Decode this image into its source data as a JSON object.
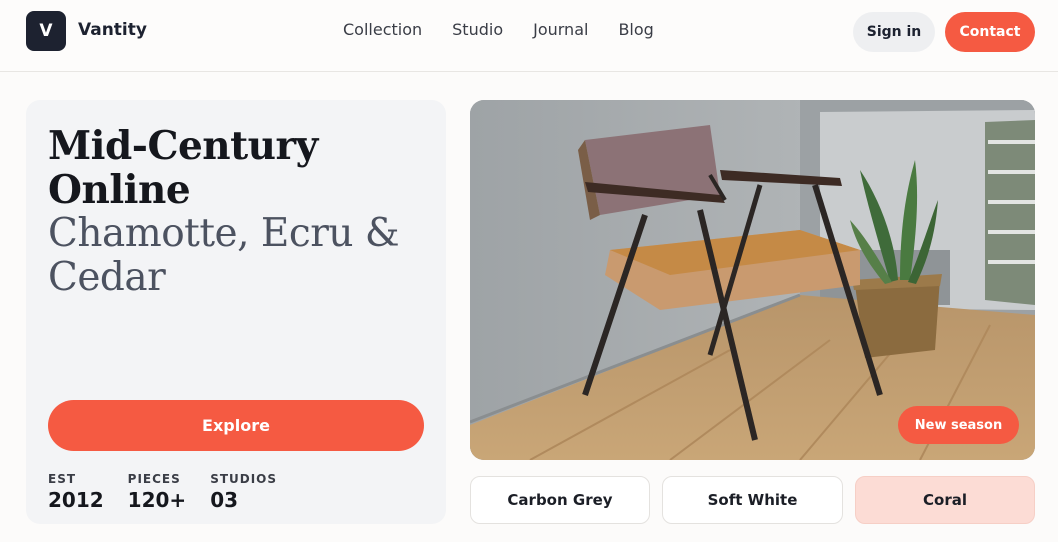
{
  "header": {
    "logo_letter": "V",
    "brand": "Vantity",
    "nav": [
      "Collection",
      "Studio",
      "Journal",
      "Blog"
    ],
    "sign_in": "Sign in",
    "contact": "Contact"
  },
  "hero": {
    "title_line1": "Mid-Century",
    "title_line2": "Online",
    "subtitle_line1": "Chamotte, Ecru &",
    "subtitle_line2": "Cedar",
    "explore": "Explore",
    "stats": [
      {
        "label": "EST",
        "value": "2012"
      },
      {
        "label": "PIECES",
        "value": "120+"
      },
      {
        "label": "STUDIOS",
        "value": "03"
      }
    ]
  },
  "photo": {
    "badge": "New season"
  },
  "swatches": [
    {
      "label": "Carbon Grey",
      "active": false
    },
    {
      "label": "Soft White",
      "active": false
    },
    {
      "label": "Coral",
      "active": true
    }
  ],
  "colors": {
    "accent": "#f55a42",
    "dark": "#1d2230",
    "swatch_active": "#fcdcd5"
  }
}
